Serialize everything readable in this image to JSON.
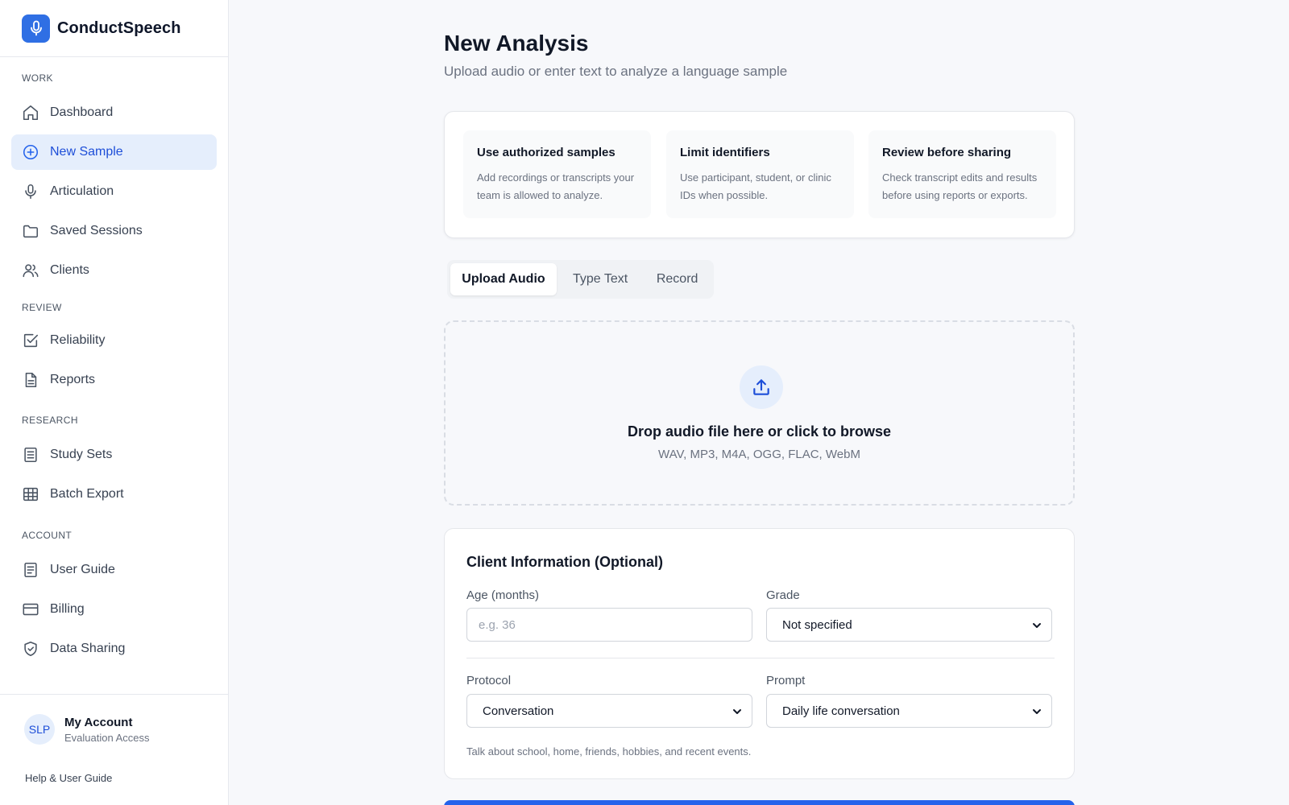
{
  "app": {
    "name": "ConductSpeech",
    "logo_icon": "microphone-icon",
    "brand_color": "#2f6fe4"
  },
  "sidebar": {
    "sections": [
      {
        "label": "WORK",
        "items": [
          {
            "label": "Dashboard",
            "icon": "home-icon"
          },
          {
            "label": "New Sample",
            "icon": "plus-circle-icon",
            "active": true
          },
          {
            "label": "Articulation",
            "icon": "microphone-icon"
          },
          {
            "label": "Saved Sessions",
            "icon": "folder-icon"
          },
          {
            "label": "Clients",
            "icon": "users-icon"
          }
        ]
      },
      {
        "label": "REVIEW",
        "items": [
          {
            "label": "Reliability",
            "icon": "checkbox-icon"
          },
          {
            "label": "Reports",
            "icon": "document-icon"
          }
        ]
      },
      {
        "label": "RESEARCH",
        "items": [
          {
            "label": "Study Sets",
            "icon": "list-icon"
          },
          {
            "label": "Batch Export",
            "icon": "table-icon"
          }
        ]
      },
      {
        "label": "ACCOUNT",
        "items": [
          {
            "label": "User Guide",
            "icon": "book-icon"
          },
          {
            "label": "Billing",
            "icon": "credit-card-icon"
          },
          {
            "label": "Data Sharing",
            "icon": "shield-icon"
          }
        ]
      }
    ],
    "account": {
      "initials": "SLP",
      "name": "My Account",
      "subtitle": "Evaluation Access"
    },
    "help_link": "Help & User Guide"
  },
  "main": {
    "title": "New Analysis",
    "subtitle": "Upload audio or enter text to analyze a language sample",
    "tips": [
      {
        "title": "Use authorized samples",
        "body": "Add recordings or transcripts your team is allowed to analyze."
      },
      {
        "title": "Limit identifiers",
        "body": "Use participant, student, or clinic IDs when possible."
      },
      {
        "title": "Review before sharing",
        "body": "Check transcript edits and results before using reports or exports."
      }
    ],
    "tabs": [
      {
        "label": "Upload Audio",
        "active": true
      },
      {
        "label": "Type Text"
      },
      {
        "label": "Record"
      }
    ],
    "dropzone": {
      "icon": "upload-icon",
      "title": "Drop audio file here or click to browse",
      "formats": "WAV, MP3, M4A, OGG, FLAC, WebM"
    },
    "client_info": {
      "title": "Client Information (Optional)",
      "age_label": "Age (months)",
      "age_placeholder": "e.g. 36",
      "grade_label": "Grade",
      "grade_value": "Not specified",
      "protocol_label": "Protocol",
      "protocol_value": "Conversation",
      "prompt_label": "Prompt",
      "prompt_value": "Daily life conversation",
      "prompt_description": "Talk about school, home, friends, hobbies, and recent events."
    }
  }
}
